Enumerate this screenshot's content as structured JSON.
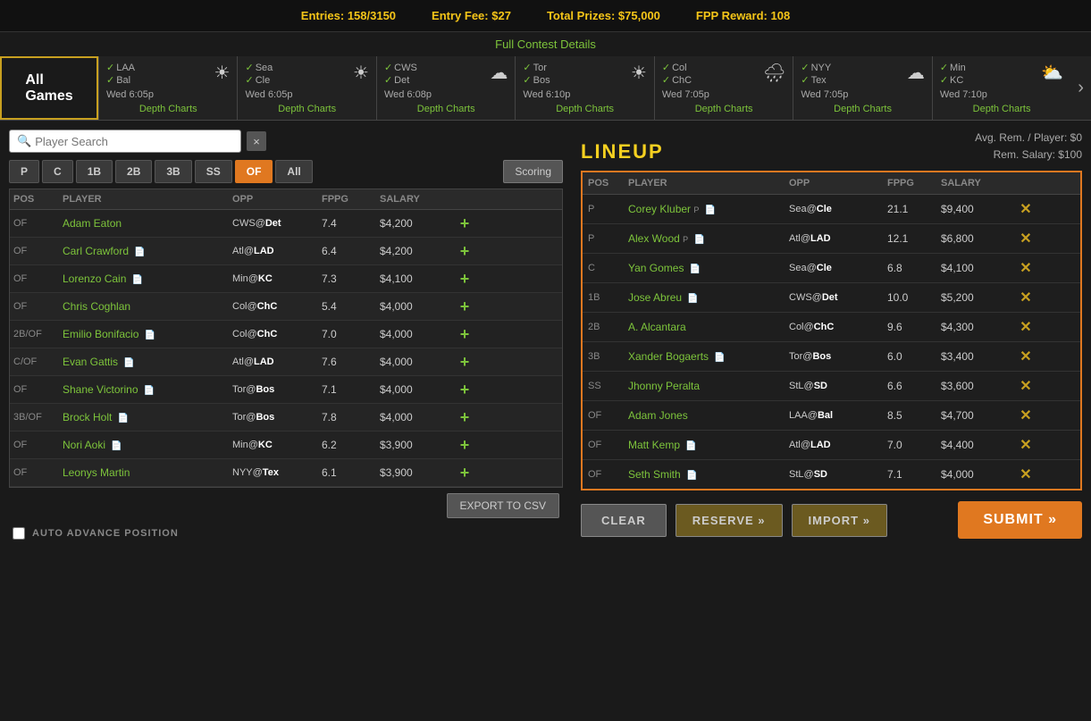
{
  "topBar": {
    "entries_label": "Entries:",
    "entries_value": "158/3150",
    "fee_label": "Entry Fee:",
    "fee_value": "$27",
    "prizes_label": "Total Prizes:",
    "prizes_value": "$75,000",
    "fpp_label": "FPP Reward:",
    "fpp_value": "108",
    "contest_details_link": "Full Contest Details"
  },
  "games": [
    {
      "id": "all",
      "label": "All\nGames",
      "active": true
    },
    {
      "team1": "LAA",
      "team2": "Bal",
      "time": "Wed 6:05p",
      "weather": "☀",
      "depth_charts": "Depth Charts"
    },
    {
      "team1": "Sea",
      "team2": "Cle",
      "time": "Wed 6:05p",
      "weather": "☀",
      "depth_charts": "Depth Charts"
    },
    {
      "team1": "CWS",
      "team2": "Det",
      "time": "Wed 6:08p",
      "weather": "☁",
      "depth_charts": "Depth Charts"
    },
    {
      "team1": "Tor",
      "team2": "Bos",
      "time": "Wed 6:10p",
      "weather": "☀",
      "depth_charts": "Depth Charts"
    },
    {
      "team1": "Col",
      "team2": "ChC",
      "time": "Wed 7:05p",
      "weather": "🌧",
      "depth_charts": "Depth Charts"
    },
    {
      "team1": "NYY",
      "team2": "Tex",
      "time": "Wed 7:05p",
      "weather": "☁",
      "depth_charts": "Depth Charts"
    },
    {
      "team1": "Min",
      "team2": "KC",
      "time": "Wed 7:10p",
      "weather": "⛅",
      "depth_charts": "Depth Charts"
    }
  ],
  "playerSearch": {
    "placeholder": "Player Search",
    "clear_label": "×"
  },
  "positionTabs": [
    "P",
    "C",
    "1B",
    "2B",
    "3B",
    "SS",
    "OF",
    "All"
  ],
  "activePosTab": "OF",
  "scoringBtn": "Scoring",
  "playerTableHeaders": [
    "POS",
    "PLAYER",
    "OPP",
    "FPPG",
    "SALARY",
    ""
  ],
  "players": [
    {
      "pos": "OF",
      "name": "Adam Eaton",
      "opp": "CWS@Det",
      "oppBold": "",
      "fppg": "7.4",
      "salary": "$4,200"
    },
    {
      "pos": "OF",
      "name": "Carl Crawford",
      "opp": "Atl@LAD",
      "oppBold": "LAD",
      "fppg": "6.4",
      "salary": "$4,200",
      "doc": true
    },
    {
      "pos": "OF",
      "name": "Lorenzo Cain",
      "opp": "Min@KC",
      "oppBold": "KC",
      "fppg": "7.3",
      "salary": "$4,100",
      "doc": true
    },
    {
      "pos": "OF",
      "name": "Chris Coghlan",
      "opp": "Col@ChC",
      "oppBold": "ChC",
      "fppg": "5.4",
      "salary": "$4,000"
    },
    {
      "pos": "2B/OF",
      "name": "Emilio Bonifacio",
      "opp": "Col@ChC",
      "oppBold": "ChC",
      "fppg": "7.0",
      "salary": "$4,000",
      "doc": true
    },
    {
      "pos": "C/OF",
      "name": "Evan Gattis",
      "opp": "Atl@LAD",
      "oppBold": "LAD",
      "fppg": "7.6",
      "salary": "$4,000",
      "doc": true
    },
    {
      "pos": "OF",
      "name": "Shane Victorino",
      "opp": "Tor@Bos",
      "oppBold": "Bos",
      "fppg": "7.1",
      "salary": "$4,000",
      "doc": true
    },
    {
      "pos": "3B/OF",
      "name": "Brock Holt",
      "opp": "Tor@Bos",
      "oppBold": "Bos",
      "fppg": "7.8",
      "salary": "$4,000",
      "doc": true
    },
    {
      "pos": "OF",
      "name": "Nori Aoki",
      "opp": "Min@KC",
      "oppBold": "KC",
      "fppg": "6.2",
      "salary": "$3,900",
      "doc": true
    },
    {
      "pos": "OF",
      "name": "Leonys Martin",
      "opp": "NYY@Tex",
      "oppBold": "Tex",
      "fppg": "6.1",
      "salary": "$3,900"
    }
  ],
  "exportBtn": "EXPORT TO CSV",
  "autoAdvance": {
    "label": "AUTO ADVANCE POSITION"
  },
  "lineup": {
    "title": "LINEUP",
    "avg_rem_label": "Avg. Rem. / Player: $0",
    "rem_salary_label": "Rem. Salary: $100",
    "headers": [
      "POS",
      "PLAYER",
      "OPP",
      "FPPG",
      "SALARY",
      ""
    ],
    "players": [
      {
        "pos": "P",
        "name": "Corey Kluber",
        "doc": true,
        "posNote": "P",
        "opp": "Sea@Cle",
        "oppBold": "Cle",
        "fppg": "21.1",
        "salary": "$9,400"
      },
      {
        "pos": "P",
        "name": "Alex Wood",
        "doc": true,
        "posNote": "P",
        "opp": "Atl@LAD",
        "oppBold": "LAD",
        "fppg": "12.1",
        "salary": "$6,800"
      },
      {
        "pos": "C",
        "name": "Yan Gomes",
        "doc": true,
        "opp": "Sea@Cle",
        "oppBold": "Cle",
        "fppg": "6.8",
        "salary": "$4,100"
      },
      {
        "pos": "1B",
        "name": "Jose Abreu",
        "doc": true,
        "opp": "CWS@Det",
        "oppBold": "Det",
        "fppg": "10.0",
        "salary": "$5,200"
      },
      {
        "pos": "2B",
        "name": "A. Alcantara",
        "opp": "Col@ChC",
        "oppBold": "ChC",
        "fppg": "9.6",
        "salary": "$4,300"
      },
      {
        "pos": "3B",
        "name": "Xander Bogaerts",
        "doc": true,
        "opp": "Tor@Bos",
        "oppBold": "Bos",
        "fppg": "6.0",
        "salary": "$3,400"
      },
      {
        "pos": "SS",
        "name": "Jhonny Peralta",
        "opp": "StL@SD",
        "oppBold": "SD",
        "fppg": "6.6",
        "salary": "$3,600"
      },
      {
        "pos": "OF",
        "name": "Adam Jones",
        "opp": "LAA@Bal",
        "oppBold": "Bal",
        "fppg": "8.5",
        "salary": "$4,700"
      },
      {
        "pos": "OF",
        "name": "Matt Kemp",
        "doc": true,
        "opp": "Atl@LAD",
        "oppBold": "LAD",
        "fppg": "7.0",
        "salary": "$4,400"
      },
      {
        "pos": "OF",
        "name": "Seth Smith",
        "doc": true,
        "opp": "StL@SD",
        "oppBold": "SD",
        "fppg": "7.1",
        "salary": "$4,000"
      }
    ]
  },
  "buttons": {
    "clear": "CLEAR",
    "reserve": "RESERVE »",
    "import": "IMPORT »",
    "submit": "SUBMIT »"
  }
}
